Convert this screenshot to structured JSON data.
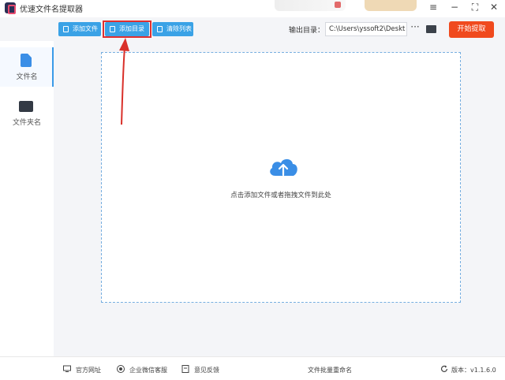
{
  "app": {
    "title": "优速文件名提取器"
  },
  "window": {
    "menu_icon": "≡",
    "minimize_icon": "−",
    "maximize_icon": "⛶",
    "close_icon": "✕"
  },
  "toolbar": {
    "add_file_label": "添加文件",
    "add_folder_label": "添加目录",
    "clear_list_label": "清除列表",
    "output_label": "输出目录：",
    "output_path": "C:\\Users\\yssoft2\\Deskt",
    "more_label": "···",
    "start_label": "开始提取"
  },
  "sidebar": {
    "items": [
      {
        "label": "文件名",
        "icon": "file-icon",
        "active": true
      },
      {
        "label": "文件夹名",
        "icon": "folder-icon",
        "active": false
      }
    ]
  },
  "dropzone": {
    "hint": "点击添加文件或者拖拽文件到此处",
    "icon": "cloud-upload-icon"
  },
  "statusbar": {
    "website": "官方网址",
    "wechat_support": "企业微信客服",
    "feedback": "意见反馈",
    "batch_rename": "文件批量重命名",
    "version": "版本：v1.1.6.0"
  },
  "colors": {
    "accent": "#3aa2e6",
    "start": "#f04a1e",
    "highlight": "#e03030"
  }
}
